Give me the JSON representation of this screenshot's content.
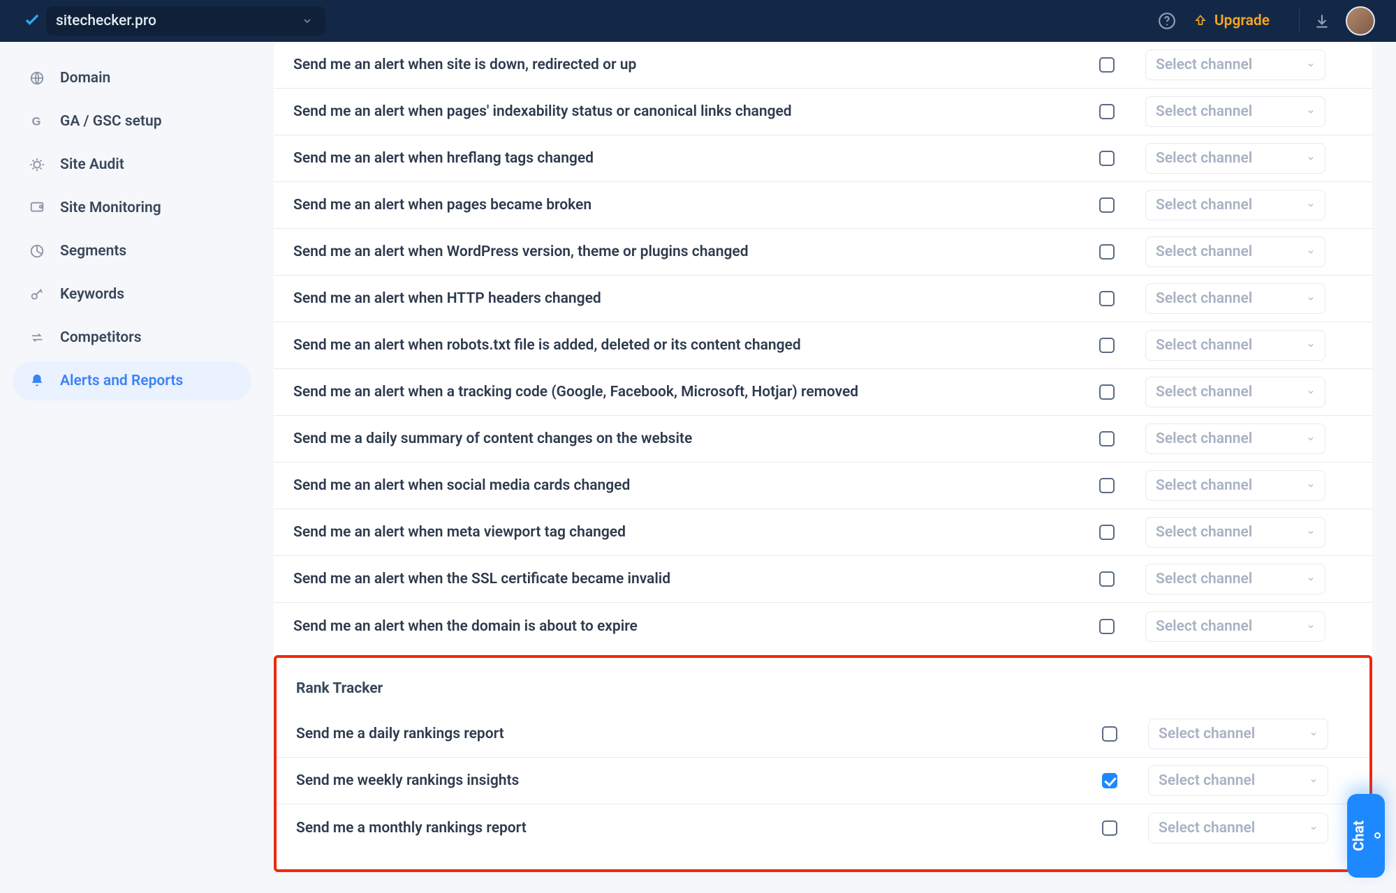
{
  "header": {
    "project": "sitechecker.pro",
    "upgrade": "Upgrade"
  },
  "sidebar": {
    "items": [
      {
        "icon": "globe",
        "label": "Domain"
      },
      {
        "icon": "g",
        "label": "GA / GSC setup"
      },
      {
        "icon": "bug",
        "label": "Site Audit"
      },
      {
        "icon": "monitor",
        "label": "Site Monitoring"
      },
      {
        "icon": "pie",
        "label": "Segments"
      },
      {
        "icon": "key",
        "label": "Keywords"
      },
      {
        "icon": "swap",
        "label": "Competitors"
      },
      {
        "icon": "bell",
        "label": "Alerts and Reports"
      }
    ],
    "activeIndex": 7
  },
  "select_placeholder": "Select channel",
  "alerts_site_monitoring": [
    {
      "label": "Send me an alert when site is down, redirected or up",
      "checked": false
    },
    {
      "label": "Send me an alert when pages' indexability status or canonical links changed",
      "checked": false
    },
    {
      "label": "Send me an alert when hreflang tags changed",
      "checked": false
    },
    {
      "label": "Send me an alert when pages became broken",
      "checked": false
    },
    {
      "label": "Send me an alert when WordPress version, theme or plugins changed",
      "checked": false
    },
    {
      "label": "Send me an alert when HTTP headers changed",
      "checked": false
    },
    {
      "label": "Send me an alert when robots.txt file is added, deleted or its content changed",
      "checked": false
    },
    {
      "label": "Send me an alert when a tracking code (Google, Facebook, Microsoft, Hotjar) removed",
      "checked": false
    },
    {
      "label": "Send me a daily summary of content changes on the website",
      "checked": false
    },
    {
      "label": "Send me an alert when social media cards changed",
      "checked": false
    },
    {
      "label": "Send me an alert when meta viewport tag changed",
      "checked": false
    },
    {
      "label": "Send me an alert when the SSL certificate became invalid",
      "checked": false
    },
    {
      "label": "Send me an alert when the domain is about to expire",
      "checked": false
    }
  ],
  "rank_tracker": {
    "title": "Rank Tracker",
    "rows": [
      {
        "label": "Send me a daily rankings report",
        "checked": false
      },
      {
        "label": "Send me weekly rankings insights",
        "checked": true
      },
      {
        "label": "Send me a monthly rankings report",
        "checked": false
      }
    ]
  },
  "chat_label": "Chat"
}
